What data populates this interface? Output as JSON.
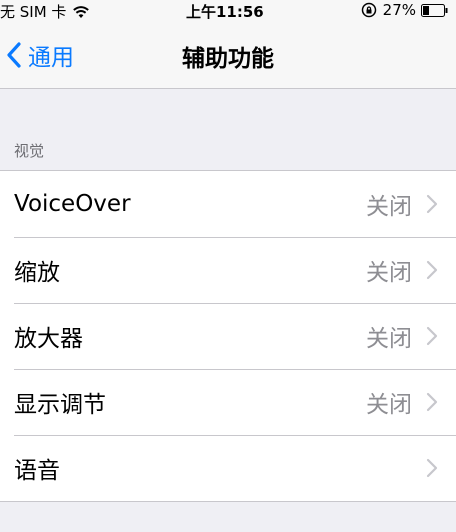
{
  "status_bar": {
    "carrier": "无 SIM 卡",
    "time": "上午11:56",
    "battery": "27%"
  },
  "nav": {
    "back_label": "通用",
    "title": "辅助功能"
  },
  "section": {
    "header": "视觉",
    "items": [
      {
        "label": "VoiceOver",
        "value": "关闭"
      },
      {
        "label": "缩放",
        "value": "关闭"
      },
      {
        "label": "放大器",
        "value": "关闭"
      },
      {
        "label": "显示调节",
        "value": "关闭"
      },
      {
        "label": "语音",
        "value": ""
      }
    ]
  },
  "colors": {
    "accent": "#0a7aff",
    "background": "#efeff4",
    "secondary_text": "#8e8e93"
  }
}
